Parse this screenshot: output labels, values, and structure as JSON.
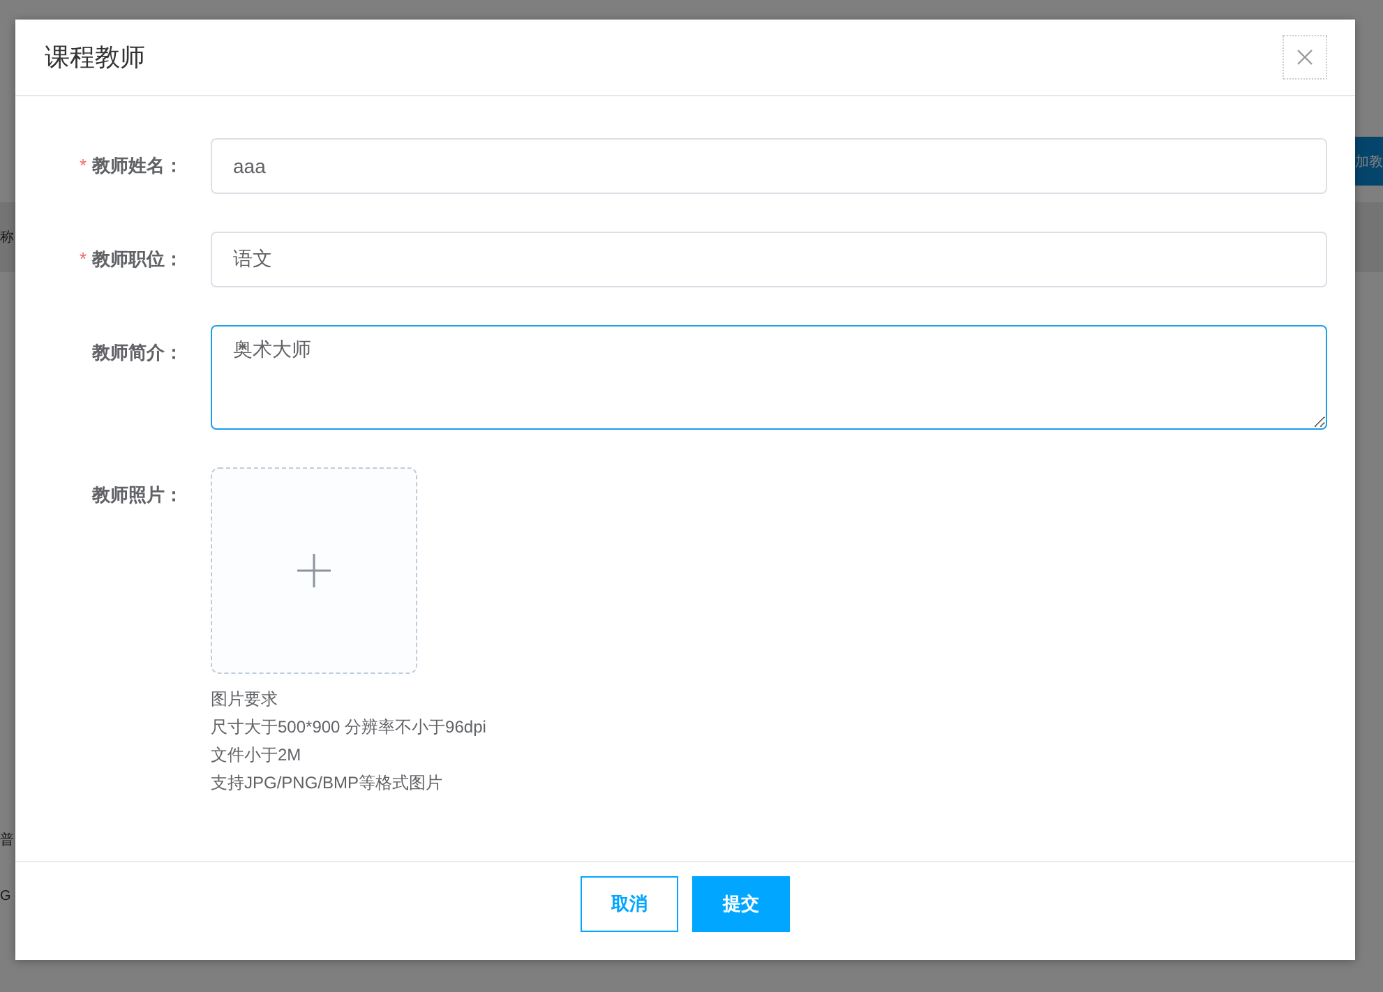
{
  "background_page": {
    "add_button": "加教",
    "table_header": "称",
    "text_lines": [
      "普",
      "G"
    ]
  },
  "dialog": {
    "title": "课程教师",
    "fields": [
      {
        "kind": "input",
        "label": "教师姓名：",
        "required_mark": "*",
        "value": "aaa",
        "focused": false
      },
      {
        "kind": "input",
        "label": "教师职位：",
        "required_mark": "*",
        "value": "语文",
        "focused": false
      },
      {
        "kind": "textarea",
        "label": "教师简介：",
        "value": "奥术大师",
        "focused": true
      },
      {
        "kind": "upload",
        "label": "教师照片：",
        "hints": [
          "图片要求",
          "尺寸大于500*900 分辨率不小于96dpi",
          "文件小于2M",
          "支持JPG/PNG/BMP等格式图片"
        ]
      }
    ],
    "buttons": [
      {
        "label": "取消",
        "kind": "secondary"
      },
      {
        "label": "提交",
        "kind": "primary"
      }
    ]
  }
}
